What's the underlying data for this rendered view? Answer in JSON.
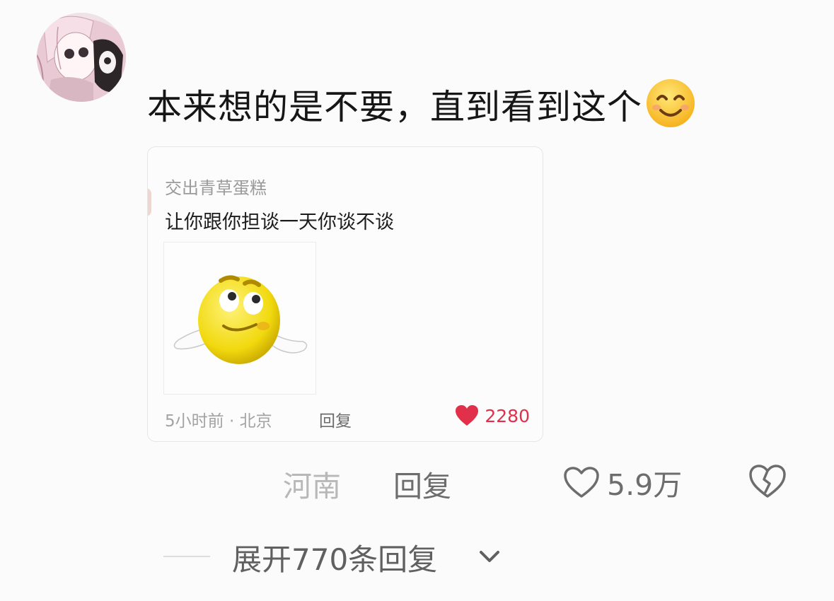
{
  "comment": {
    "avatar_icon": "anime-avatar-icon",
    "text": "本来想的是不要，直到看到这个",
    "emoji": "smiling-face-icon"
  },
  "quote": {
    "username": "交出青草蛋糕",
    "text": "让你跟你担谈一天你谈不谈",
    "image_icon": "shrugging-emoji-face-icon",
    "meta": "5小时前 · 北京",
    "reply_label": "回复",
    "like_count": "2280",
    "like_color": "#e0304a"
  },
  "actions": {
    "location": "河南",
    "reply_label": "回复",
    "like_count": "5.9万",
    "dislike_icon": "broken-heart-icon"
  },
  "expand": {
    "label": "展开770条回复"
  }
}
